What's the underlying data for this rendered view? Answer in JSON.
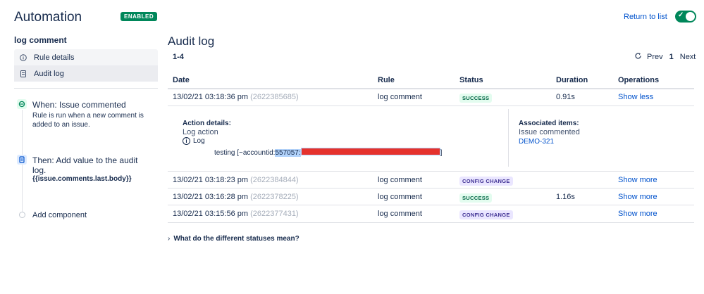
{
  "header": {
    "title": "Automation",
    "badge": "ENABLED",
    "return_link": "Return to list",
    "toggle_check": "✓"
  },
  "sidebar": {
    "rule_name": "log comment",
    "nav": [
      {
        "label": "Rule details",
        "icon": "info-icon"
      },
      {
        "label": "Audit log",
        "icon": "document-icon"
      }
    ],
    "steps": {
      "when_title": "When: Issue commented",
      "when_desc": "Rule is run when a new comment is added to an issue.",
      "then_title": "Then: Add value to the audit log.",
      "then_code": "{{issue.comments.last.body}}",
      "add_component": "Add component"
    }
  },
  "main": {
    "title": "Audit log",
    "range": "1-4",
    "pager": {
      "prev": "Prev",
      "current": "1",
      "next": "Next"
    },
    "columns": [
      "Date",
      "Rule",
      "Status",
      "Duration",
      "Operations"
    ],
    "rows": [
      {
        "date": "13/02/21 03:18:36 pm",
        "id": "(2622385685)",
        "rule": "log comment",
        "status": "SUCCESS",
        "duration": "0.91s",
        "operation": "Show less"
      },
      {
        "date": "13/02/21 03:18:23 pm",
        "id": "(2622384844)",
        "rule": "log comment",
        "status": "CONFIG CHANGE",
        "duration": "",
        "operation": "Show more"
      },
      {
        "date": "13/02/21 03:16:28 pm",
        "id": "(2622378225)",
        "rule": "log comment",
        "status": "SUCCESS",
        "duration": "1.16s",
        "operation": "Show more"
      },
      {
        "date": "13/02/21 03:15:56 pm",
        "id": "(2622377431)",
        "rule": "log comment",
        "status": "CONFIG CHANGE",
        "duration": "",
        "operation": "Show more"
      }
    ],
    "details": {
      "action_label": "Action details:",
      "action_name": "Log action",
      "log_label": "Log",
      "log_prefix": "testing [~accountid:",
      "log_account": "557057:",
      "log_suffix": "]",
      "assoc_label": "Associated items:",
      "assoc_text": "Issue commented",
      "assoc_link": "DEMO-321"
    },
    "faq": "What do the different statuses mean?"
  },
  "colors": {
    "accent": "#0052cc",
    "success": "#00875a",
    "config": "#403294",
    "redaction": "#e5322d"
  }
}
